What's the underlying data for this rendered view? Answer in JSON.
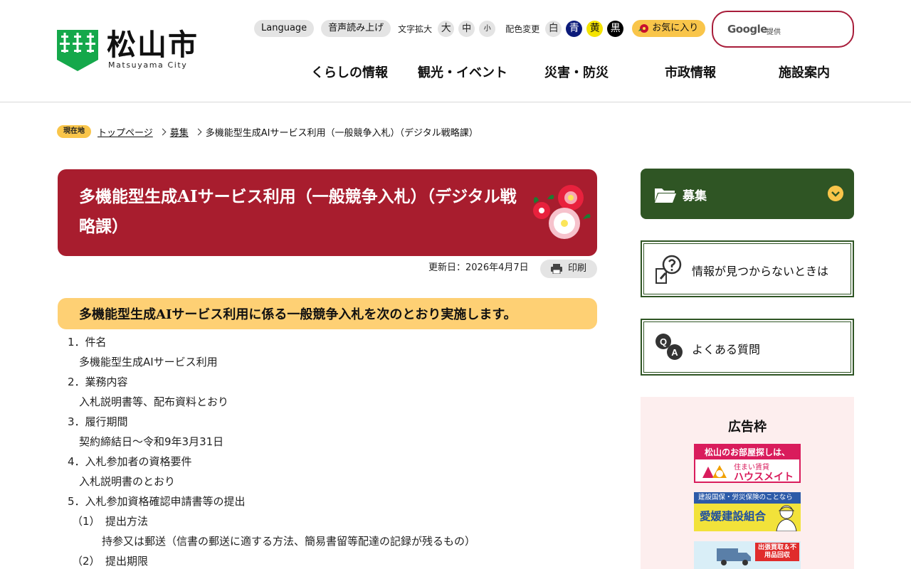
{
  "header": {
    "logo_name": "松山市",
    "logo_sub": "Matsuyama City",
    "tools": {
      "language": "Language",
      "voice": "音声読み上げ",
      "text_size_label": "文字拡大",
      "size_large": "大",
      "size_medium": "中",
      "size_small": "小",
      "color_label": "配色変更",
      "color_white": "白",
      "color_blue": "青",
      "color_yellow": "黄",
      "color_black": "黒",
      "favorite": "お気に入り"
    },
    "search": {
      "brand": "Google",
      "provided": "提供",
      "placeholder": ""
    },
    "nav": [
      "くらしの情報",
      "観光・イベント",
      "災害・防災",
      "市政情報",
      "施設案内"
    ]
  },
  "breadcrumb": {
    "here_label": "現在地",
    "items": [
      "トップページ",
      "募集"
    ],
    "current": "多機能型生成AIサービス利用（一般競争入札）（デジタル戦略課）"
  },
  "main": {
    "title": "多機能型生成AIサービス利用（一般競争入札）（デジタル戦略課）",
    "updated": "更新日：2026年4月7日",
    "print": "印刷",
    "section_heading": "多機能型生成AIサービス利用に係る一般競争入札を次のとおり実施します。",
    "lines": [
      "1．件名",
      "多機能型生成AIサービス利用",
      "2．業務内容",
      "入札説明書等、配布資料とおり",
      "3．履行期間",
      "契約締結日～令和9年3月31日",
      "4．入札参加者の資格要件",
      "入札説明書のとおり",
      "5．入札参加資格確認申請書等の提出",
      "（1）　提出方法",
      "持参又は郵送（信書の郵送に適する方法、簡易書留等配達の記録が残るもの）",
      "（2）　提出期限"
    ]
  },
  "sidebar": {
    "category": "募集",
    "not_found": "情報が見つからないときは",
    "faq": "よくある質問",
    "ad_title": "広告枠",
    "ads": {
      "ad1_top": "松山のお部屋探しは、",
      "ad1_sub": "住まい賃貸",
      "ad1_name": "ハウスメイト",
      "ad2_top": "建設国保・労災保険のことなら",
      "ad2_name": "愛媛建設組合",
      "ad3_text": "出張買取＆不用品回収"
    }
  },
  "colors": {
    "brand_red": "#a81d2e",
    "brand_green": "#2f5524",
    "accent_yellow": "#f9c54a",
    "section_yellow": "#fed074"
  }
}
